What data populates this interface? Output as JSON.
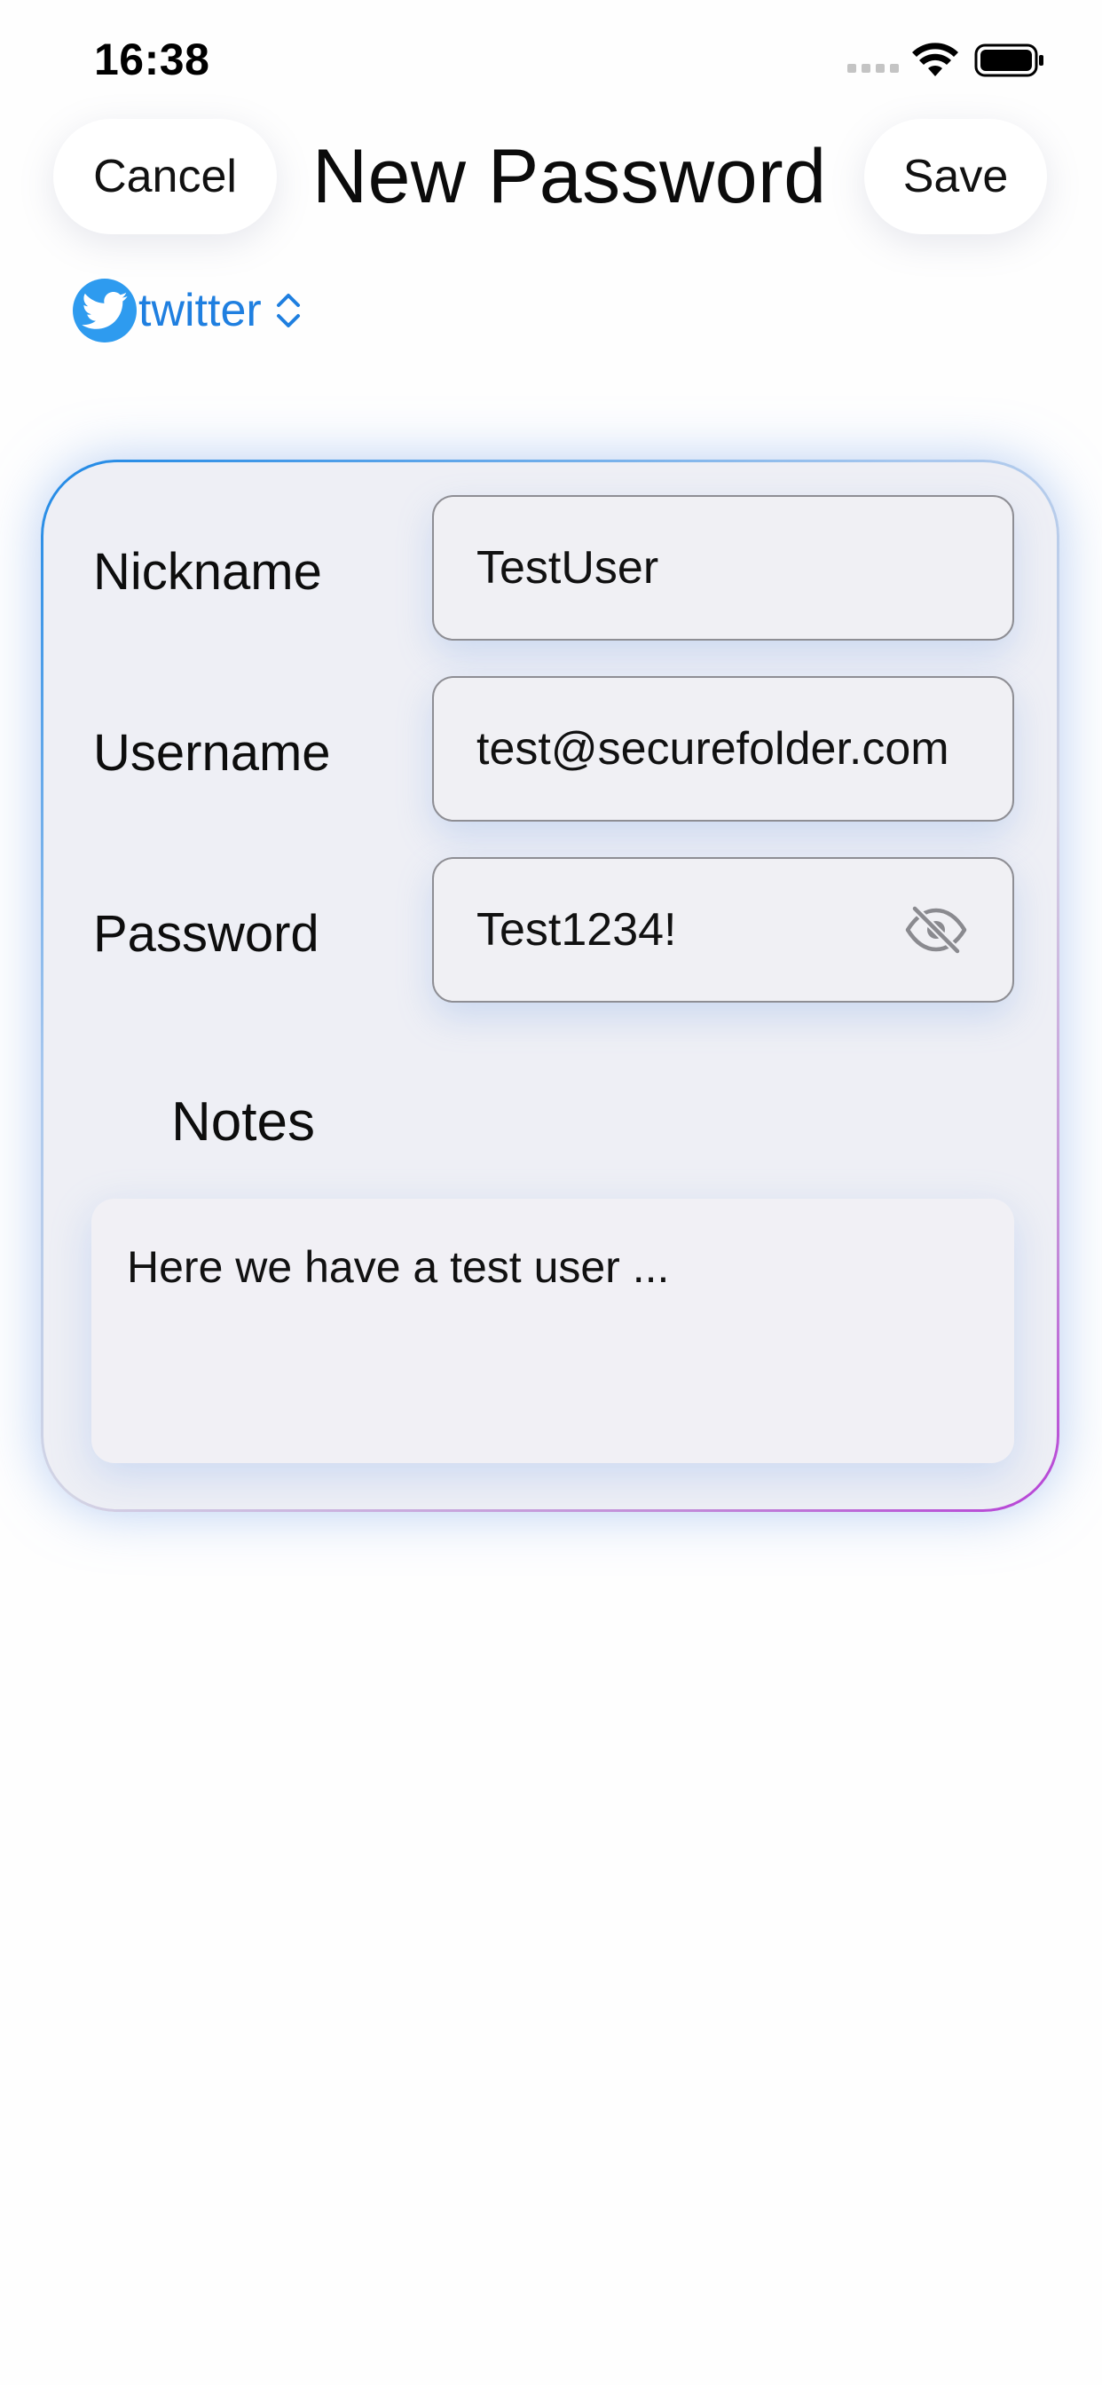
{
  "status_bar": {
    "time": "16:38"
  },
  "nav": {
    "cancel_label": "Cancel",
    "title": "New Password",
    "save_label": "Save"
  },
  "account": {
    "label": "twitter",
    "icon": "twitter-bird-icon",
    "color": "#1f7fe0"
  },
  "form": {
    "nickname_label": "Nickname",
    "nickname_value": "TestUser",
    "username_label": "Username",
    "username_value": "test@securefolder.com",
    "password_label": "Password",
    "password_value": "Test1234!",
    "password_toggle_icon": "eye-slash-icon",
    "notes_label": "Notes",
    "notes_value": "Here we have a test user ..."
  },
  "colors": {
    "card_border_start": "#1e88e5",
    "card_border_end": "#b73fd6",
    "card_background": "#eeeff5",
    "field_border": "#8e8e94"
  }
}
